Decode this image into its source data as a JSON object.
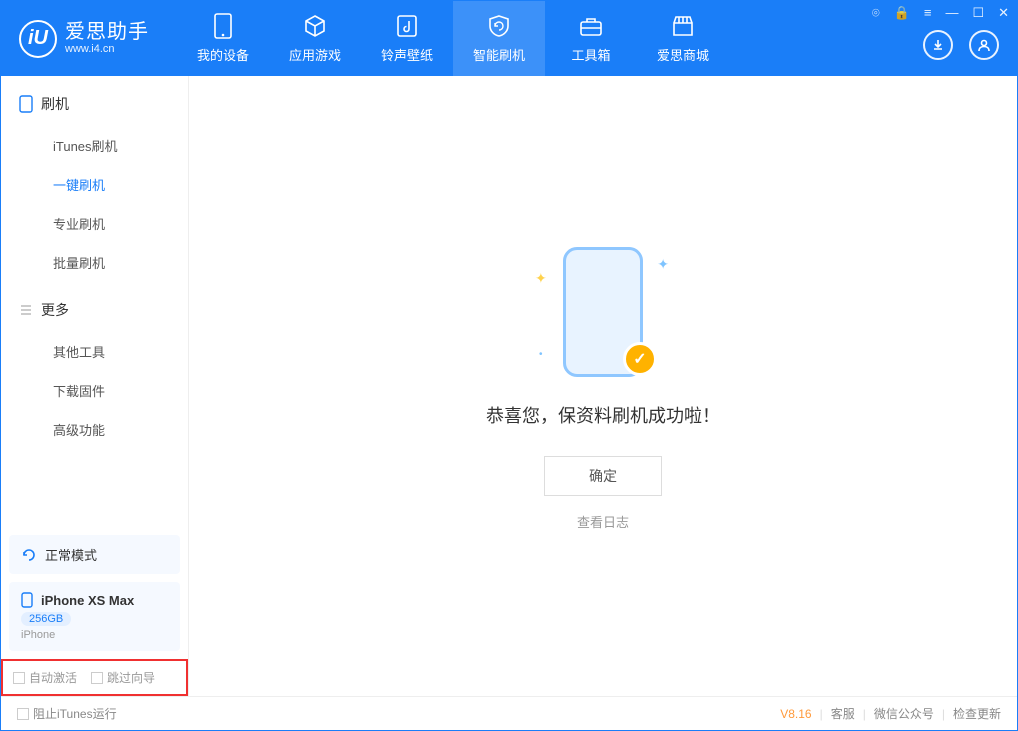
{
  "app": {
    "name": "爱思助手",
    "url": "www.i4.cn",
    "logo_letter": "iU"
  },
  "tabs": [
    {
      "label": "我的设备"
    },
    {
      "label": "应用游戏"
    },
    {
      "label": "铃声壁纸"
    },
    {
      "label": "智能刷机"
    },
    {
      "label": "工具箱"
    },
    {
      "label": "爱思商城"
    }
  ],
  "sidebar": {
    "section1": {
      "title": "刷机",
      "items": [
        "iTunes刷机",
        "一键刷机",
        "专业刷机",
        "批量刷机"
      ],
      "active_index": 1
    },
    "section2": {
      "title": "更多",
      "items": [
        "其他工具",
        "下载固件",
        "高级功能"
      ]
    }
  },
  "device": {
    "mode_label": "正常模式",
    "name": "iPhone XS Max",
    "capacity": "256GB",
    "type": "iPhone"
  },
  "bottom_checks": {
    "auto_activate": "自动激活",
    "skip_guide": "跳过向导"
  },
  "main": {
    "success_text": "恭喜您，保资料刷机成功啦！",
    "ok_button": "确定",
    "view_log": "查看日志"
  },
  "statusbar": {
    "block_itunes": "阻止iTunes运行",
    "version": "V8.16",
    "links": [
      "客服",
      "微信公众号",
      "检查更新"
    ]
  }
}
